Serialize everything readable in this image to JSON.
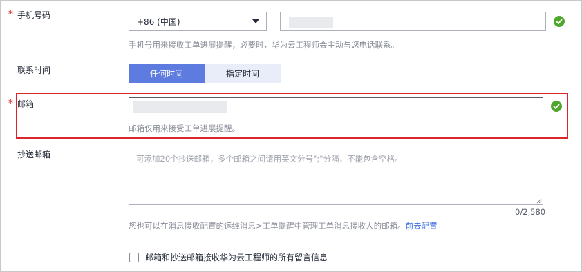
{
  "phone": {
    "label": "手机号码",
    "required_mark": "*",
    "country_code": "+86 (中国)",
    "separator": "-",
    "number_value": "",
    "valid": true,
    "hint": "手机号用来接收工单进展提醒；必要时，华为云工程师会主动与您电话联系。"
  },
  "contact_time": {
    "label": "联系时间",
    "options": [
      "任何时间",
      "指定时间"
    ],
    "selected_index": 0
  },
  "email": {
    "label": "邮箱",
    "required_mark": "*",
    "value": "",
    "valid": true,
    "hint": "邮箱仅用来接受工单进展提醒。"
  },
  "cc_email": {
    "label": "抄送邮箱",
    "placeholder": "可添加20个抄送邮箱，多个邮箱之间请用英文分号\";\"分隔，不能包含空格。",
    "counter": "0/2,580",
    "hint_prefix": "您也可以在消息接收配置的运维消息>工单提醒中管理工单消息接收人的邮箱。",
    "hint_link": "前去配置"
  },
  "consent": {
    "label": "邮箱和抄送邮箱接收华为云工程师的所有留言信息",
    "checked": false
  },
  "colors": {
    "required": "#e02c2c",
    "accent": "#5e7ce0",
    "success": "#50a72e",
    "highlight_border": "#d9262c",
    "link": "#3d6ee0"
  }
}
